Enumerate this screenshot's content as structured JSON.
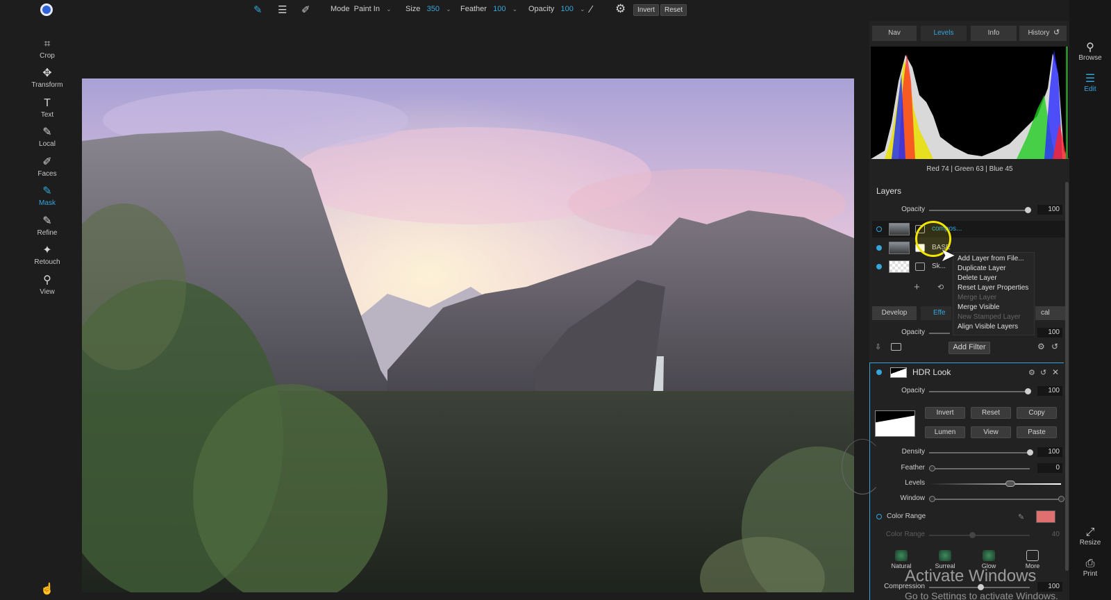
{
  "topbar": {
    "mode_label": "Mode",
    "mode_value": "Paint In",
    "size_label": "Size",
    "size_value": "350",
    "feather_label": "Feather",
    "feather_value": "100",
    "opacity_label": "Opacity",
    "opacity_value": "100",
    "invert": "Invert",
    "reset": "Reset"
  },
  "left_tools": [
    "Crop",
    "Transform",
    "Text",
    "Local",
    "Faces",
    "Mask",
    "Refine",
    "Retouch",
    "View"
  ],
  "right_tools": {
    "browse": "Browse",
    "edit": "Edit",
    "resize": "Resize",
    "print": "Print"
  },
  "nav_tabs": [
    "Nav",
    "Levels",
    "Info",
    "History"
  ],
  "rgb_readout": "Red  74  | Green  63  | Blue  45",
  "layers": {
    "title": "Layers",
    "opacity_label": "Opacity",
    "opacity_value": "100",
    "items": [
      {
        "name": "compos..."
      },
      {
        "name": "BASE"
      },
      {
        "name": "Sk..."
      }
    ]
  },
  "context_menu": {
    "items": [
      "Add Layer from File...",
      "Duplicate Layer",
      "Delete Layer",
      "Reset Layer Properties",
      "Merge Layer",
      "Merge Visible",
      "New Stamped Layer",
      "Align Visible Layers"
    ]
  },
  "panel_tabs": {
    "develop": "Develop",
    "effects": "Effe",
    "local": "cal"
  },
  "effects": {
    "opacity_label": "Opacity",
    "opacity_value": "100",
    "add_filter": "Add Filter"
  },
  "hdr": {
    "title": "HDR Look",
    "opacity_label": "Opacity",
    "opacity_value": "100",
    "buttons": [
      "Invert",
      "Reset",
      "Copy",
      "Lumen",
      "View",
      "Paste"
    ],
    "density_label": "Density",
    "density_value": "100",
    "feather_label": "Feather",
    "feather_value": "0",
    "levels_label": "Levels",
    "window_label": "Window",
    "color_range_label": "Color Range",
    "color_range_slider_label": "Color Range",
    "color_range_value": "40",
    "color_swatch": "#e07070",
    "presets": [
      "Natural",
      "Surreal",
      "Glow",
      "More"
    ],
    "compression_label": "Compression",
    "compression_value": "100"
  },
  "watermark": {
    "line1": "Activate Windows",
    "line2": "Go to Settings to activate Windows."
  },
  "colors": {
    "accent": "#35a6dc"
  }
}
